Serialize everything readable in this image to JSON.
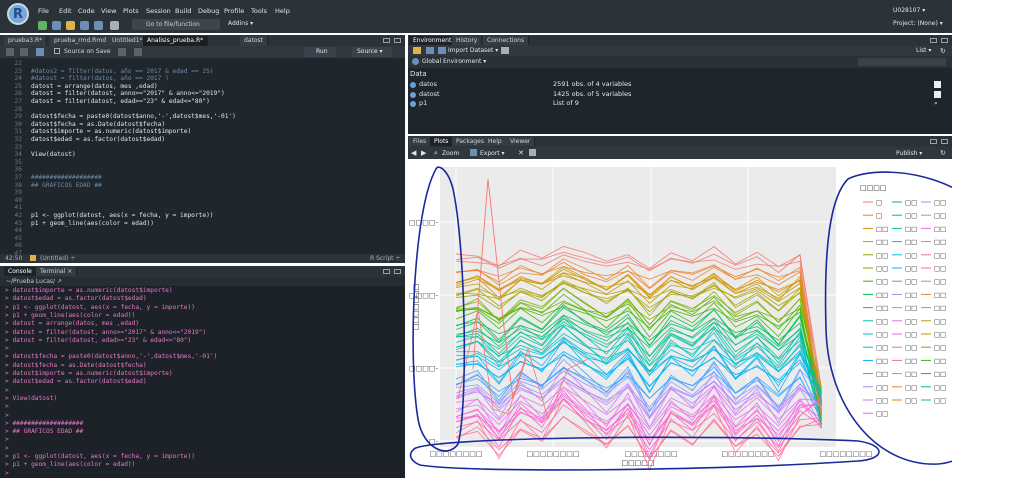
{
  "menu": [
    "File",
    "Edit",
    "Code",
    "View",
    "Plots",
    "Session",
    "Build",
    "Debug",
    "Profile",
    "Tools",
    "Help"
  ],
  "toolbar": {
    "goto": "Go to file/function",
    "addins": "Addins ▾"
  },
  "user": "U028107 ▾",
  "project": "Project: (None) ▾",
  "editor_tabs": [
    "prueba3.R*",
    "prueba_rmd.Rmd",
    "Untitled1*",
    "Analisis_prueba.R*",
    "datost"
  ],
  "editor_toolbar": {
    "source_on_save": "Source on Save",
    "run": "Run",
    "source": "Source ▾"
  },
  "editor_lines": [
    {
      "n": "22",
      "t": "",
      "k": "code"
    },
    {
      "n": "23",
      "t": "#datos2 = filter(datos, año == 2017 & edad == 25)",
      "k": "com"
    },
    {
      "n": "24",
      "t": "#datost = filter(datos, año == 2017 )",
      "k": "com"
    },
    {
      "n": "25",
      "t": "datost = arrange(datos, mes ,edad)",
      "k": "code"
    },
    {
      "n": "26",
      "t": "datost = filter(datost, anno>=\"2017\" & anno<=\"2019\")",
      "k": "code"
    },
    {
      "n": "27",
      "t": "datost = filter(datost, edad>=\"23\" & edad<=\"80\")",
      "k": "code"
    },
    {
      "n": "28",
      "t": "",
      "k": "code"
    },
    {
      "n": "29",
      "t": "datost$fecha = paste0(datost$anno,'-',datost$mes,'-01')",
      "k": "code"
    },
    {
      "n": "30",
      "t": "datost$fecha = as.Date(datost$fecha)",
      "k": "code"
    },
    {
      "n": "31",
      "t": "datost$importe = as.numeric(datost$importe)",
      "k": "code"
    },
    {
      "n": "32",
      "t": "datost$edad = as.factor(datost$edad)",
      "k": "code"
    },
    {
      "n": "33",
      "t": "",
      "k": "code"
    },
    {
      "n": "34",
      "t": "View(datost)",
      "k": "code"
    },
    {
      "n": "35",
      "t": "",
      "k": "code"
    },
    {
      "n": "36",
      "t": "",
      "k": "code"
    },
    {
      "n": "37",
      "t": "###################",
      "k": "com"
    },
    {
      "n": "38",
      "t": "## GRAFICOS EDAD ##",
      "k": "com"
    },
    {
      "n": "39",
      "t": "",
      "k": "code"
    },
    {
      "n": "40",
      "t": "",
      "k": "code"
    },
    {
      "n": "41",
      "t": "",
      "k": "code"
    },
    {
      "n": "42",
      "t": "p1 <- ggplot(datost, aes(x = fecha, y = importe))",
      "k": "code"
    },
    {
      "n": "43",
      "t": "p1 + geom_line(aes(color = edad))",
      "k": "code"
    },
    {
      "n": "44",
      "t": "",
      "k": "code"
    },
    {
      "n": "45",
      "t": "",
      "k": "code"
    },
    {
      "n": "46",
      "t": "",
      "k": "code"
    },
    {
      "n": "47",
      "t": "",
      "k": "code"
    }
  ],
  "editor_status": {
    "pos": "42:50",
    "scope": "(Untitled) ÷",
    "type": "R Script ÷"
  },
  "console_tabs": [
    "Console",
    "Terminal ×"
  ],
  "console_path": "~/Prueba Lucas/ ↗",
  "console_lines": [
    "> datost$importe = as.numeric(datost$importe)",
    "> datost$edad = as.factor(datost$edad)",
    "> p1 <- ggplot(datost, aes(x = fecha, y = importe))",
    "> p1 + geom_line(aes(color = edad))",
    "> datost = arrange(datos, mes ,edad)",
    "> datost = filter(datost, anno>=\"2017\" & anno<=\"2019\")",
    "> datost = filter(datost, edad>=\"23\" & edad<=\"80\")",
    ">",
    "> datost$fecha = paste0(datost$anno,'-',datost$mes,'-01')",
    "> datost$fecha = as.Date(datost$fecha)",
    "> datost$importe = as.numeric(datost$importe)",
    "> datost$edad = as.factor(datost$edad)",
    ">",
    "> View(datost)",
    ">",
    ">",
    "> ###################",
    "> ## GRAFICOS EDAD ##",
    ">",
    ">",
    "> p1 <- ggplot(datost, aes(x = fecha, y = importe))",
    "> p1 + geom_line(aes(color = edad))",
    ">"
  ],
  "env_tabs": [
    "Environment",
    "History",
    "Connections"
  ],
  "env_toolbar": {
    "import": "Import Dataset ▾",
    "list": "List ▾"
  },
  "env_scope": "Global Environment ▾",
  "env_section": "Data",
  "env_rows": [
    {
      "name": "datos",
      "value": "2591 obs. of 4 variables"
    },
    {
      "name": "datost",
      "value": "1425 obs. of 5 variables"
    },
    {
      "name": "p1",
      "value": "List of 9"
    }
  ],
  "files_tabs": [
    "Files",
    "Plots",
    "Packages",
    "Help",
    "Viewer"
  ],
  "files_toolbar": {
    "zoom": "Zoom",
    "export": "Export ▾",
    "publish": "Publish ▾"
  },
  "plot": {
    "legend_title": "□□□□",
    "y_title": "□□□□□□□",
    "x_title": "□□□□□",
    "y_ticks": [
      "□□□□-",
      "□□□□-",
      "□□□□-",
      "□-"
    ],
    "x_ticks": [
      "□□□□□□□□",
      "□□□□□□□□",
      "□□□□□□□□",
      "□□□□□□□□",
      "□□□□□□□□"
    ],
    "legend_col1": [
      "□",
      "□",
      "□□",
      "□□",
      "□□",
      "□□",
      "□□",
      "□□",
      "□□",
      "□□",
      "□□",
      "□□",
      "□□",
      "□□",
      "□□",
      "□□",
      "□□"
    ],
    "legend_col2": [
      "□□",
      "□□",
      "□□",
      "□□",
      "□□",
      "□□",
      "□□",
      "□□",
      "□□",
      "□□",
      "□□",
      "□□",
      "□□",
      "□□",
      "□□",
      "□□"
    ],
    "legend_col3": [
      "□□",
      "□□",
      "□□",
      "□□",
      "□□",
      "□□",
      "□□",
      "□□",
      "□□",
      "□□",
      "□□",
      "□□",
      "□□",
      "□□",
      "□□",
      "□□"
    ]
  },
  "colors": {
    "annotation": "#1a2a9c",
    "panel_bg": "#ebebeb"
  }
}
